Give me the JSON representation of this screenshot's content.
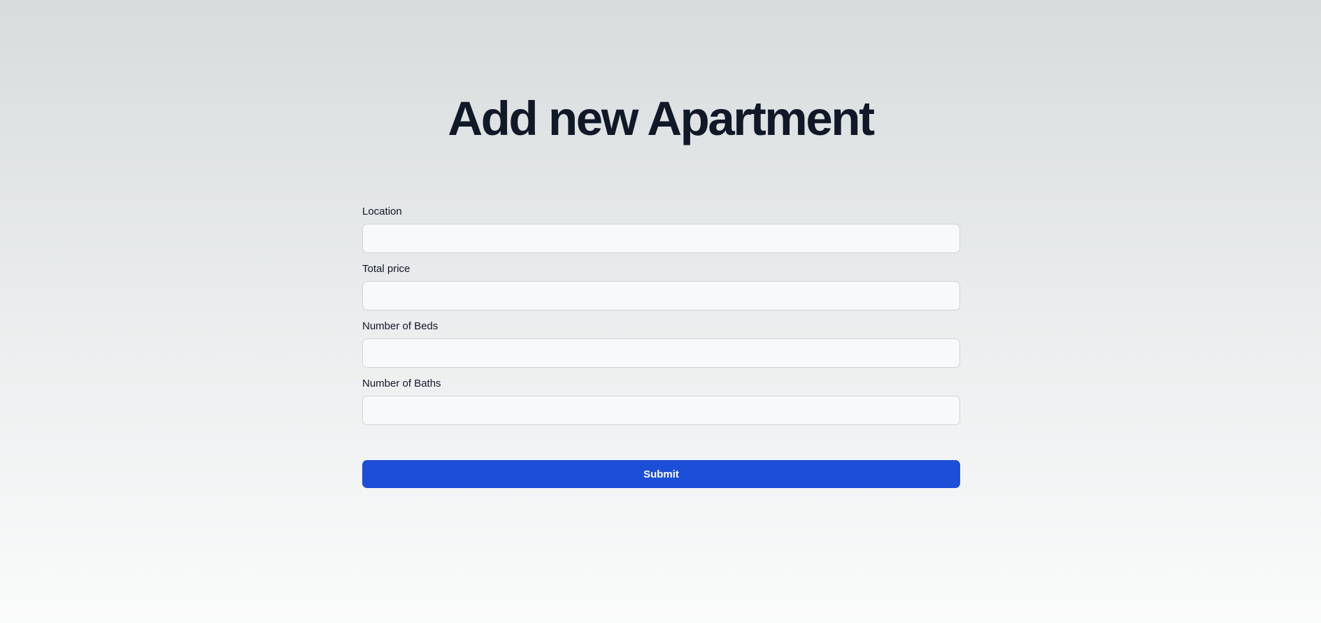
{
  "page": {
    "title": "Add new Apartment"
  },
  "form": {
    "fields": [
      {
        "label": "Location",
        "value": "",
        "placeholder": ""
      },
      {
        "label": "Total price",
        "value": "",
        "placeholder": ""
      },
      {
        "label": "Number of Beds",
        "value": "",
        "placeholder": ""
      },
      {
        "label": "Number of Baths",
        "value": "",
        "placeholder": ""
      }
    ],
    "submit_label": "Submit"
  },
  "colors": {
    "accent": "#1d4ed8",
    "heading": "#111827",
    "input_background": "#f8f9fb",
    "input_border": "#cfd3d8"
  }
}
